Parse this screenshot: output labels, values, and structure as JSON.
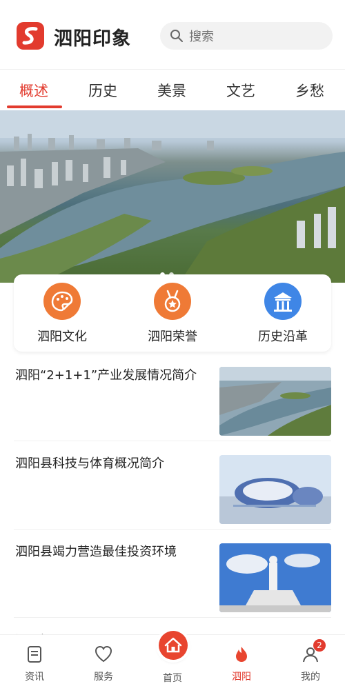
{
  "header": {
    "app_title": "泗阳印象",
    "search_placeholder": "搜索",
    "brand_color": "#e23b2e"
  },
  "tabs": [
    {
      "label": "概述",
      "active": true
    },
    {
      "label": "历史",
      "active": false
    },
    {
      "label": "美景",
      "active": false
    },
    {
      "label": "文艺",
      "active": false
    },
    {
      "label": "乡愁",
      "active": false
    }
  ],
  "banner": {
    "slide_count": 2,
    "active_slide": 1
  },
  "quick_links": [
    {
      "label": "泗阳文化",
      "icon": "palette-icon",
      "color": "#ef7a36"
    },
    {
      "label": "泗阳荣誉",
      "icon": "medal-icon",
      "color": "#ef7a36"
    },
    {
      "label": "历史沿革",
      "icon": "pavilion-icon",
      "color": "#3f86e6"
    }
  ],
  "news": [
    {
      "title": "泗阳“2+1+1”产业发展情况简介",
      "thumb": "river-city-photo"
    },
    {
      "title": "泗阳县科技与体育概况简介",
      "thumb": "stadium-photo"
    },
    {
      "title": "泗阳县竭力营造最佳投资环境",
      "thumb": "statue-photo"
    },
    {
      "title": "泗阳概况",
      "thumb": ""
    }
  ],
  "bottom_nav": [
    {
      "label": "资讯",
      "icon": "news-icon",
      "active": false
    },
    {
      "label": "服务",
      "icon": "heart-icon",
      "active": false
    },
    {
      "label": "首页",
      "icon": "home-icon",
      "active": false
    },
    {
      "label": "泗阳",
      "icon": "flame-icon",
      "active": true
    },
    {
      "label": "我的",
      "icon": "user-icon",
      "active": false,
      "badge": "2"
    }
  ]
}
